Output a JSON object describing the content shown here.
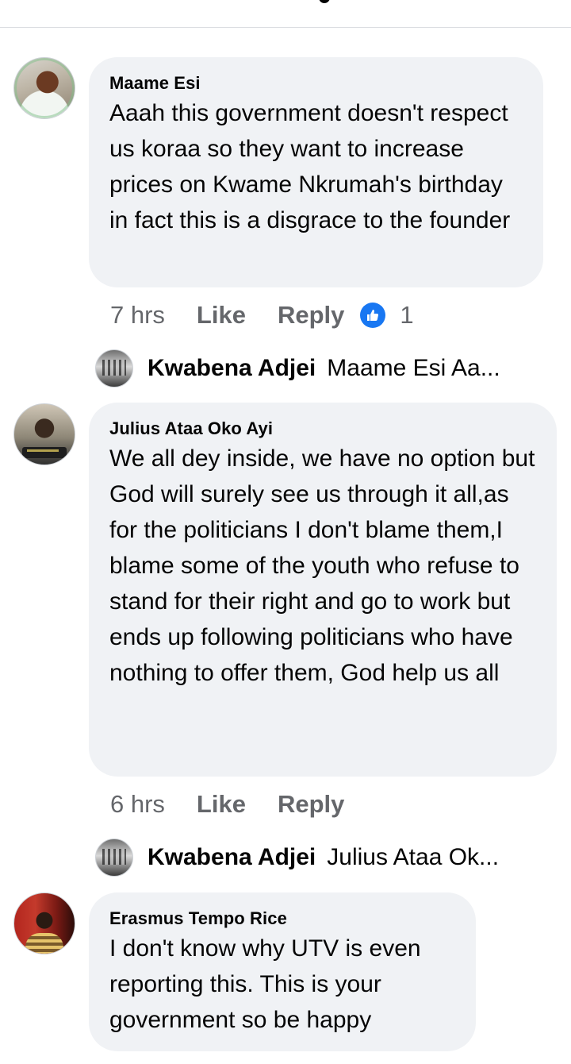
{
  "comments": [
    {
      "author": "Maame Esi",
      "text": "Aaah this government doesn't respect us koraa so they want to increase prices on Kwame Nkrumah's birthday in fact this is a disgrace to the founder",
      "time": "7 hrs",
      "like_label": "Like",
      "reply_label": "Reply",
      "reaction_count": "1",
      "reply_preview": {
        "name": "Kwabena Adjei",
        "snippet": "Maame Esi Aa..."
      }
    },
    {
      "author": "Julius Ataa Oko Ayi",
      "text": "We all dey inside, we have no option but God will surely see us through it all,as for the politicians I don't blame them,I blame some of the youth who refuse to stand for their right and go to work but ends up following politicians who have nothing to offer them, God help us all",
      "time": "6 hrs",
      "like_label": "Like",
      "reply_label": "Reply",
      "reply_preview": {
        "name": "Kwabena Adjei",
        "snippet": "Julius Ataa Ok..."
      }
    },
    {
      "author": "Erasmus Tempo Rice",
      "text": "I don't know why UTV is even reporting this. This is your government so be happy"
    }
  ],
  "icons": {
    "reaction": "thumbs-up-icon",
    "reaction_color": "#1877f2"
  },
  "colors": {
    "bubble_bg": "#f0f2f5",
    "meta_text": "#65676b"
  }
}
